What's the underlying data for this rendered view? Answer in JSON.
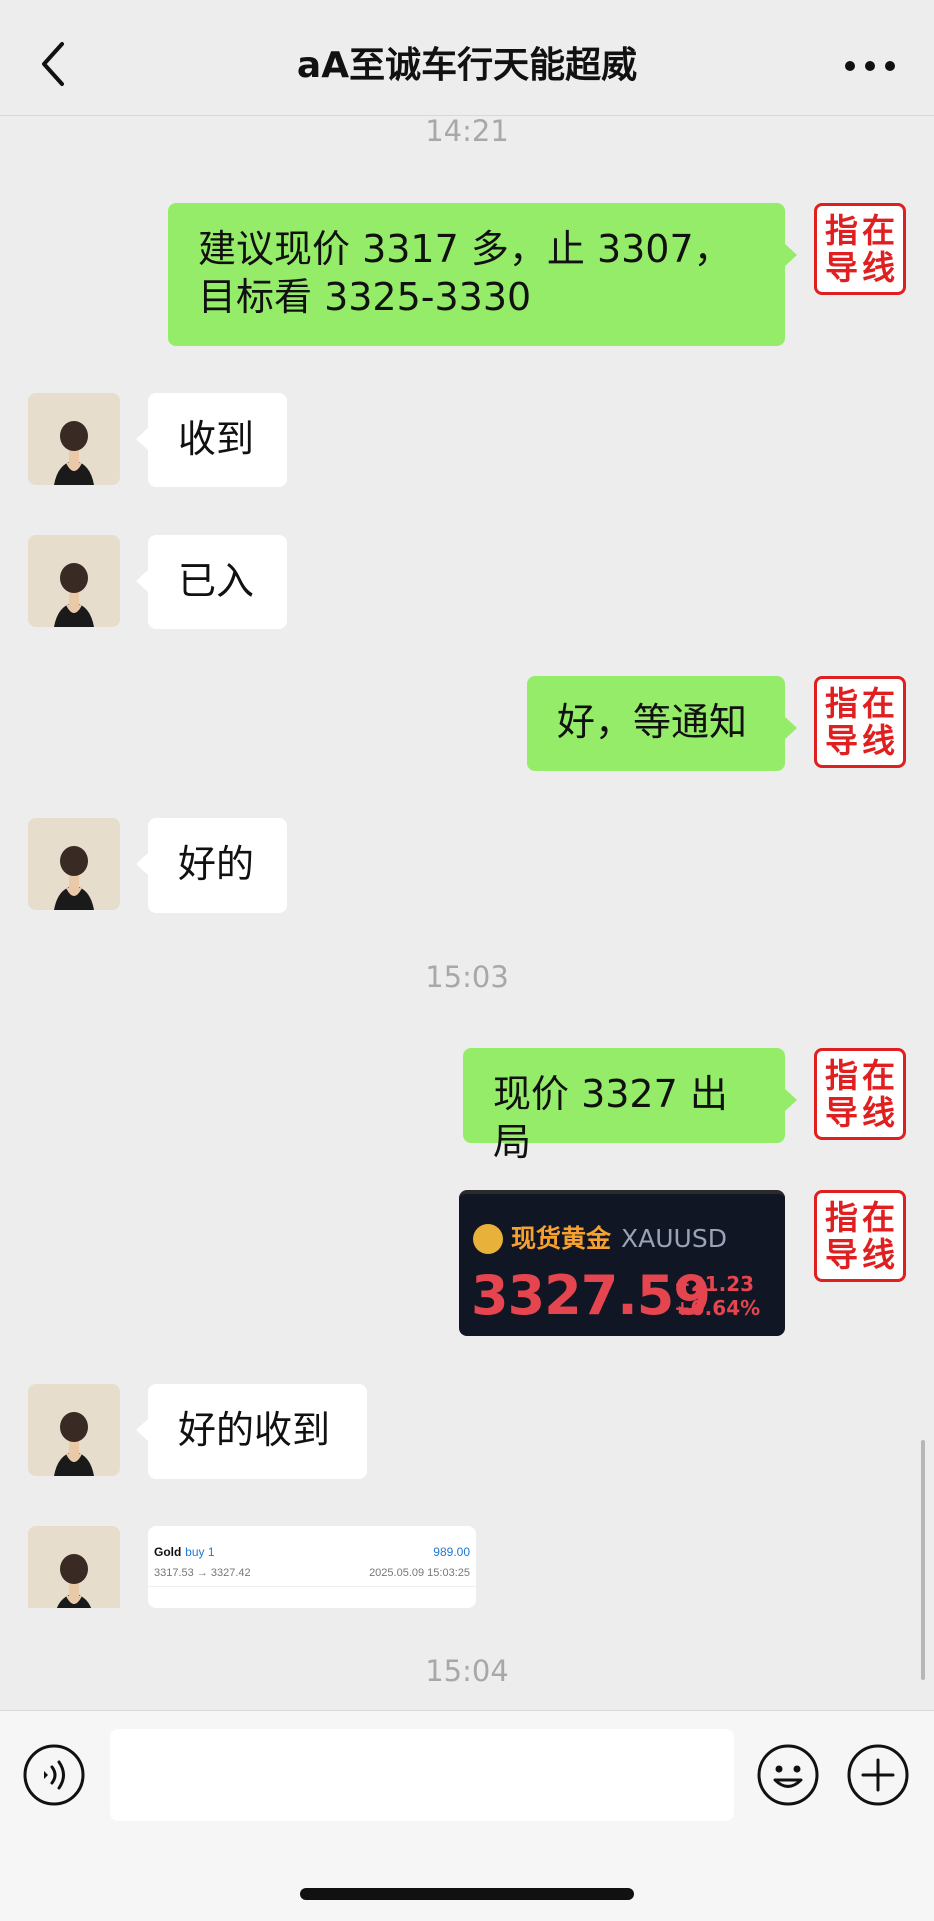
{
  "header": {
    "title": "aA至诚车行天能超威",
    "back_icon": "chevron-left-icon",
    "more_icon": "more-dots-icon"
  },
  "seal_text": [
    "指",
    "在",
    "导",
    "线"
  ],
  "timestamps": [
    "14:21",
    "15:03",
    "15:04"
  ],
  "messages": [
    {
      "side": "out",
      "text": "建议现价 3317 多，止 3307，目标看 3325-3330"
    },
    {
      "side": "in",
      "text": "收到"
    },
    {
      "side": "in",
      "text": "已入"
    },
    {
      "side": "out",
      "text": "好，等通知"
    },
    {
      "side": "in",
      "text": "好的"
    },
    {
      "side": "out",
      "text": "现价 3327 出局"
    },
    {
      "side": "in",
      "text": "好的收到"
    }
  ],
  "gold_card": {
    "name": "现货黄金",
    "symbol": "XAUUSD",
    "price": "3327.59",
    "change": "+21.23",
    "change_pct": "+0.64%"
  },
  "trade_card": {
    "instrument": "Gold",
    "direction": "buy 1",
    "profit": "989.00",
    "prices": "3317.53 → 3327.42",
    "datetime": "2025.05.09 15:03:25"
  },
  "input_bar": {
    "voice_icon": "voice-icon",
    "emoji_icon": "emoji-icon",
    "plus_icon": "plus-icon",
    "message_value": ""
  },
  "colors": {
    "outgoing_bubble": "#95ec69",
    "incoming_bubble": "#ffffff",
    "background": "#ededed",
    "seal_red": "#e02020",
    "gold_price_red": "#e4454e"
  }
}
